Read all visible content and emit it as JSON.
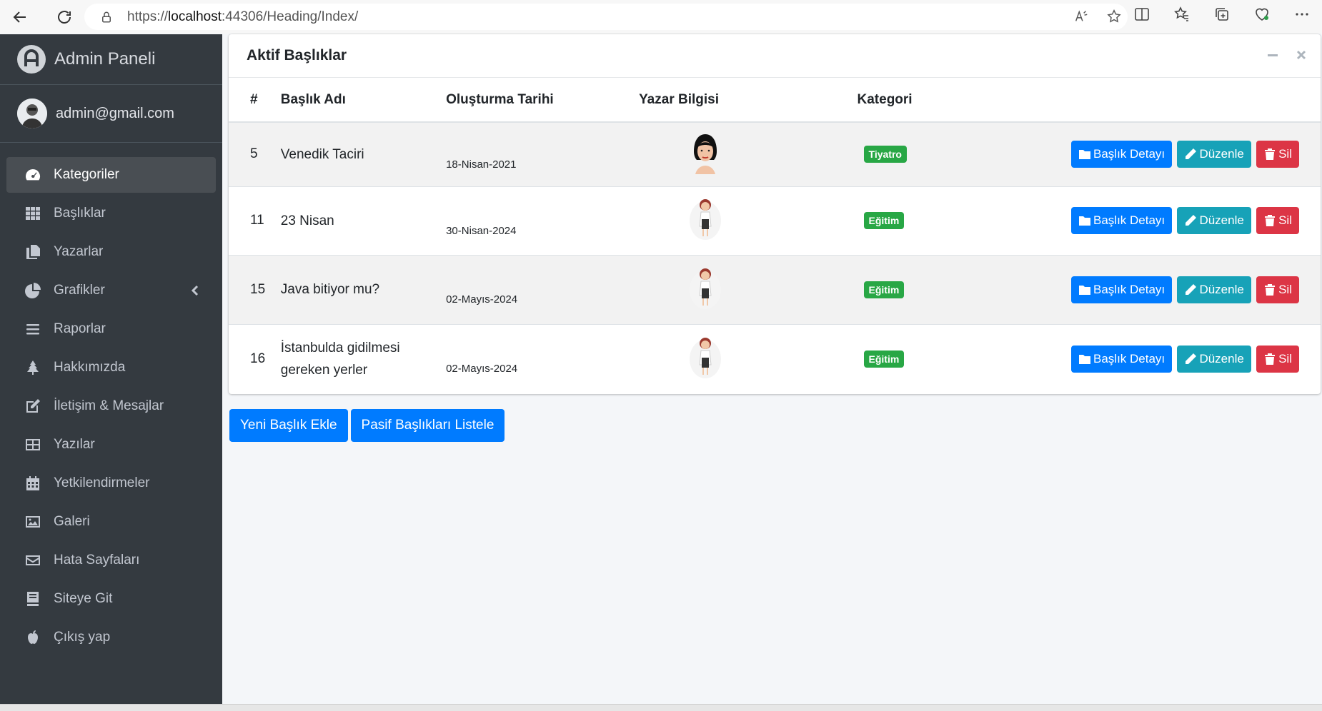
{
  "browser": {
    "url_prefix": "https://",
    "url_host": "localhost",
    "url_rest": ":44306/Heading/Index/"
  },
  "sidebar": {
    "brand": "Admin Paneli",
    "user": "admin@gmail.com",
    "items": [
      {
        "label": "Kategoriler",
        "icon": "dashboard-icon"
      },
      {
        "label": "Başlıklar",
        "icon": "grid-icon"
      },
      {
        "label": "Yazarlar",
        "icon": "copy-icon"
      },
      {
        "label": "Grafikler",
        "icon": "pie-chart-icon"
      },
      {
        "label": "Raporlar",
        "icon": "list-icon"
      },
      {
        "label": "Hakkımızda",
        "icon": "tree-icon"
      },
      {
        "label": "İletişim & Mesajlar",
        "icon": "edit-icon"
      },
      {
        "label": "Yazılar",
        "icon": "table-icon"
      },
      {
        "label": "Yetkilendirmeler",
        "icon": "calendar-icon"
      },
      {
        "label": "Galeri",
        "icon": "image-icon"
      },
      {
        "label": "Hata Sayfaları",
        "icon": "envelope-icon"
      },
      {
        "label": "Siteye Git",
        "icon": "book-icon"
      },
      {
        "label": "Çıkış yap",
        "icon": "apple-icon"
      }
    ]
  },
  "card": {
    "title": "Aktif Başlıklar",
    "columns": [
      "#",
      "Başlık Adı",
      "Oluşturma Tarihi",
      "Yazar Bilgisi",
      "Kategori"
    ],
    "rows": [
      {
        "id": "5",
        "name": "Venedik Taciri",
        "date": "18-Nisan-2021",
        "category": "Tiyatro",
        "avatar": "woman-portrait"
      },
      {
        "id": "11",
        "name": "23 Nisan",
        "date": "30-Nisan-2024",
        "category": "Eğitim",
        "avatar": "cartoon-woman"
      },
      {
        "id": "15",
        "name": "Java bitiyor mu?",
        "date": "02-Mayıs-2024",
        "category": "Eğitim",
        "avatar": "cartoon-woman"
      },
      {
        "id": "16",
        "name": "İstanbulda gidilmesi gereken yerler",
        "date": "02-Mayıs-2024",
        "category": "Eğitim",
        "avatar": "cartoon-woman"
      }
    ],
    "buttons": {
      "detail": "Başlık Detayı",
      "edit": "Düzenle",
      "delete": "Sil"
    }
  },
  "actions": {
    "new": "Yeni Başlık Ekle",
    "passive": "Pasif Başlıkları Listele"
  },
  "colors": {
    "sidebar_bg": "#343a40",
    "primary": "#007bff",
    "info": "#17a2b8",
    "danger": "#dc3545",
    "success": "#28a745"
  }
}
